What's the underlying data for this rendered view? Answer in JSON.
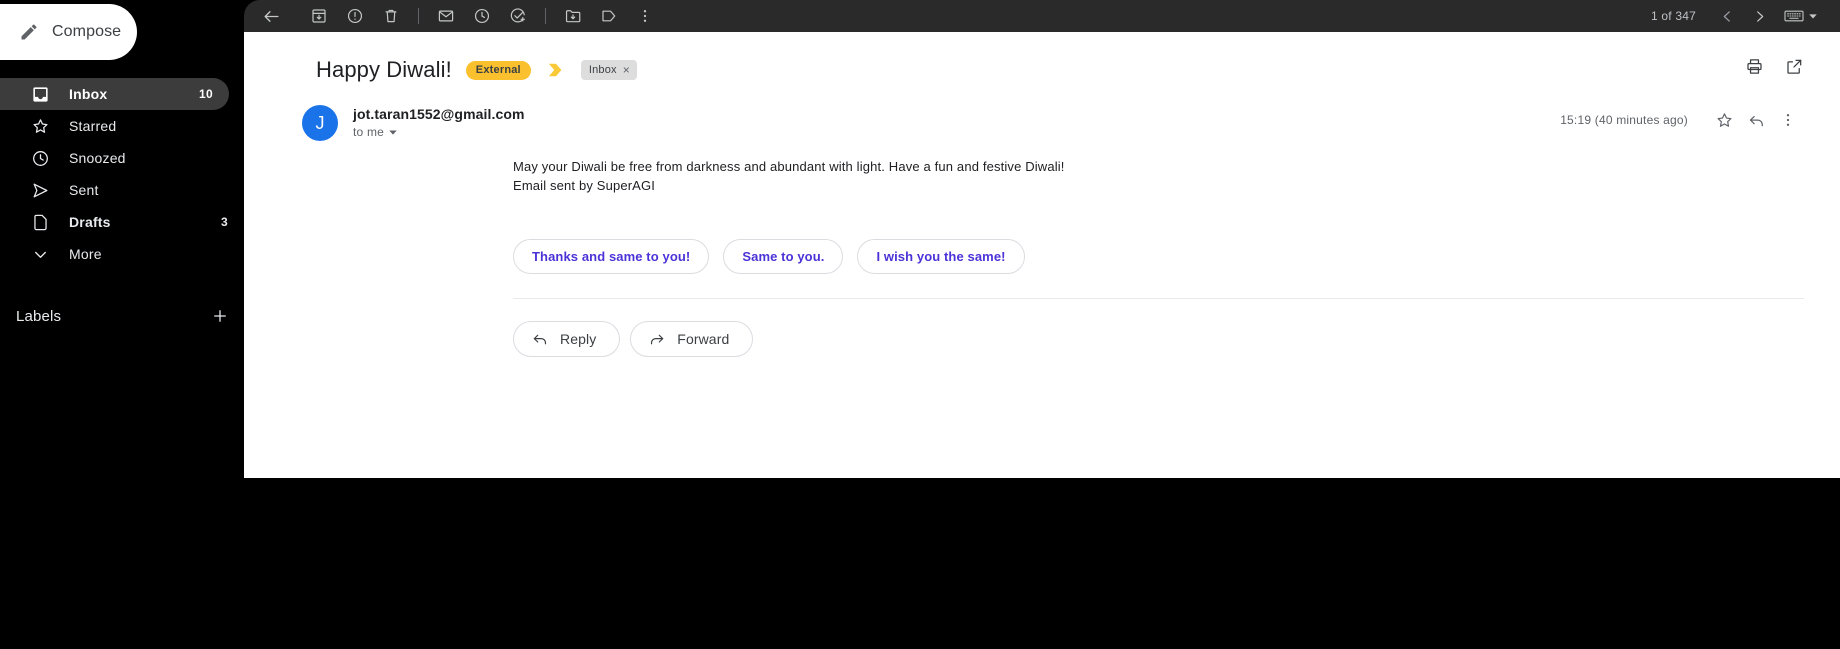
{
  "sidebar": {
    "compose": {
      "label": "Compose",
      "icon": "pencil-icon"
    },
    "items": [
      {
        "label": "Inbox",
        "count": "10",
        "icon": "inbox-icon",
        "active": true
      },
      {
        "label": "Starred",
        "count": "",
        "icon": "star-icon",
        "active": false
      },
      {
        "label": "Snoozed",
        "count": "",
        "icon": "clock-icon",
        "active": false
      },
      {
        "label": "Sent",
        "count": "",
        "icon": "send-icon",
        "active": false
      },
      {
        "label": "Drafts",
        "count": "3",
        "icon": "draft-icon",
        "active": false
      },
      {
        "label": "More",
        "count": "",
        "icon": "chevron-down-icon",
        "active": false
      }
    ],
    "labels": {
      "title": "Labels",
      "add_icon": "plus-icon"
    }
  },
  "toolbar": {
    "back_icon": "back-arrow-icon",
    "actions": [
      {
        "name": "archive-icon"
      },
      {
        "name": "report-spam-icon"
      },
      {
        "name": "delete-icon"
      }
    ],
    "actions2": [
      {
        "name": "mark-unread-icon"
      },
      {
        "name": "snooze-icon"
      },
      {
        "name": "add-to-tasks-icon"
      }
    ],
    "actions3": [
      {
        "name": "move-to-icon"
      },
      {
        "name": "label-icon"
      },
      {
        "name": "more-options-icon"
      }
    ],
    "pagination": {
      "count_text": "1 of 347",
      "prev_icon": "chevron-left-icon",
      "next_icon": "chevron-right-icon",
      "keyboard_icon": "keyboard-icon",
      "keyboard_caret": "caret-down-icon"
    }
  },
  "message": {
    "subject": "Happy Diwali!",
    "external_badge": "External",
    "important_marker": "important-marker-icon",
    "inbox_chip": {
      "label": "Inbox",
      "remove": "×"
    },
    "pane_actions": [
      {
        "name": "print-icon"
      },
      {
        "name": "open-in-new-window-icon"
      }
    ],
    "avatar_letter": "J",
    "sender": "jot.taran1552@gmail.com",
    "recipient": "to me",
    "recipient_caret": "caret-down-icon",
    "timestamp": "15:19 (40 minutes ago)",
    "header_actions": [
      {
        "name": "star-icon"
      },
      {
        "name": "reply-icon"
      },
      {
        "name": "more-options-icon"
      }
    ],
    "body_lines": [
      "May your Diwali be free from darkness and abundant with light. Have a fun and festive Diwali!",
      "Email sent by SuperAGI"
    ],
    "smart_replies": [
      "Thanks and same to you!",
      "Same to you.",
      "I wish you the same!"
    ],
    "reply_button": {
      "label": "Reply",
      "icon": "reply-icon"
    },
    "forward_button": {
      "label": "Forward",
      "icon": "forward-icon"
    }
  },
  "colors": {
    "sidebar_bg": "#000000",
    "toolbar_bg": "#2a2a2a",
    "active_nav_bg": "#3c3c3c",
    "pane_bg": "#ffffff",
    "external_badge": "#fbc02d",
    "important_marker": "#f9c938",
    "avatar": "#1a73e8",
    "smart_reply_text": "#4b33d8",
    "chip_bg": "#ddddde"
  }
}
